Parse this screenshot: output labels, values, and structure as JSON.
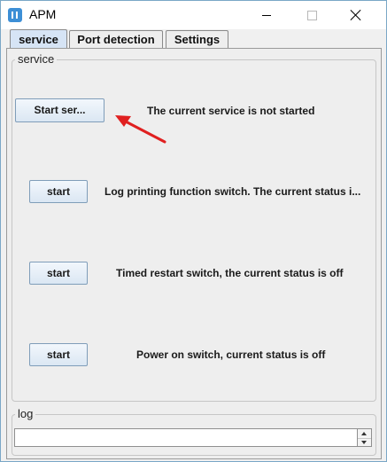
{
  "window": {
    "title": "APM",
    "icon": "app-icon",
    "controls": [
      "minimize-icon",
      "maximize-icon",
      "close-icon"
    ]
  },
  "tabs": [
    {
      "label": "service",
      "active": true
    },
    {
      "label": "Port detection",
      "active": false
    },
    {
      "label": "Settings",
      "active": false
    }
  ],
  "service_panel": {
    "title": "service",
    "rows": [
      {
        "button_label": "Start ser...",
        "status": "The current service is not started"
      },
      {
        "button_label": "start",
        "status": "Log printing function switch. The current status i..."
      },
      {
        "button_label": "start",
        "status": "Timed restart switch, the current status is off"
      },
      {
        "button_label": "start",
        "status": "Power on switch, current status is off"
      }
    ]
  },
  "log_panel": {
    "title": "log",
    "value": ""
  },
  "colors": {
    "active_tab": "#d6e4f5",
    "annotation_arrow": "#e02020",
    "window_border": "#7aa7c7"
  }
}
